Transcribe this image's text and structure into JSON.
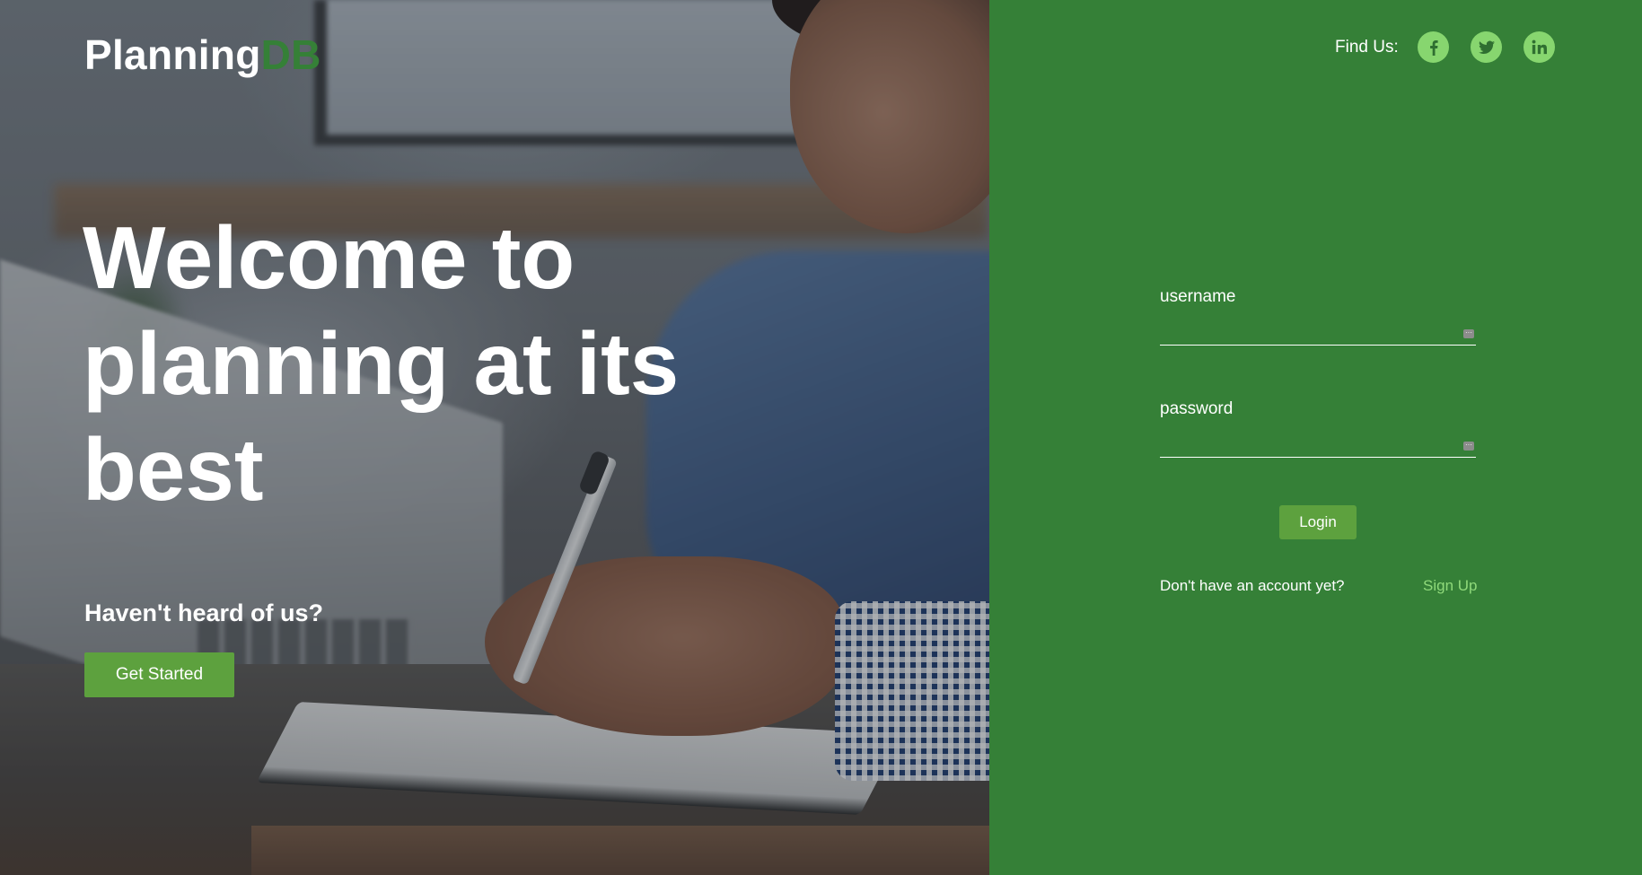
{
  "brand": {
    "name_main": "Planning",
    "name_accent": "DB"
  },
  "hero": {
    "headline": "Welcome to planning at its best",
    "tagline": "Haven't heard of us?",
    "cta_label": "Get Started",
    "background_image": "person writing in notebook at desk with laptop"
  },
  "social": {
    "label": "Find Us:",
    "links": [
      {
        "icon": "facebook-icon"
      },
      {
        "icon": "twitter-icon"
      },
      {
        "icon": "linkedin-icon"
      }
    ]
  },
  "login": {
    "username_label": "username",
    "username_value": "",
    "password_label": "password",
    "password_value": "",
    "submit_label": "Login",
    "signup_prompt": "Don't have an account yet?",
    "signup_link": "Sign Up"
  },
  "colors": {
    "panel_green": "#358037",
    "button_green": "#5da13e",
    "social_icon_bg": "#87d66f",
    "signup_link": "#8fd97a",
    "brand_accent": "#358037"
  }
}
